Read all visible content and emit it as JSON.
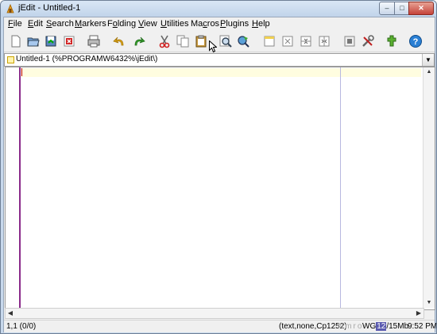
{
  "window": {
    "title": "jEdit - Untitled-1",
    "controls": {
      "minimize": "–",
      "maximize": "□",
      "close": "✕"
    }
  },
  "menu": [
    {
      "label": "File",
      "mnemonic": "F",
      "rest": "ile"
    },
    {
      "label": "Edit",
      "mnemonic": "E",
      "rest": "dit"
    },
    {
      "label": "Search",
      "mnemonic": "S",
      "rest": "earch"
    },
    {
      "label": "Markers",
      "mnemonic": "M",
      "rest": "arkers"
    },
    {
      "label": "Folding",
      "mnemonic": "o",
      "pre": "F",
      "rest": "lding"
    },
    {
      "label": "View",
      "mnemonic": "V",
      "rest": "iew"
    },
    {
      "label": "Utilities",
      "mnemonic": "U",
      "rest": "tilities"
    },
    {
      "label": "Macros",
      "mnemonic": "c",
      "pre": "Ma",
      "rest": "ros"
    },
    {
      "label": "Plugins",
      "mnemonic": "P",
      "rest": "lugins"
    },
    {
      "label": "Help",
      "mnemonic": "H",
      "rest": "elp"
    }
  ],
  "toolbar": {
    "icons": [
      "new-file-icon",
      "open-file-icon",
      "save-file-icon",
      "close-file-icon",
      "print-icon",
      "undo-icon",
      "redo-icon",
      "cut-icon",
      "copy-icon",
      "paste-icon",
      "find-icon",
      "find-next-icon",
      "new-view-icon",
      "unsplit-icon",
      "split-horizontal-icon",
      "split-vertical-icon",
      "buffer-options-icon",
      "global-options-icon",
      "plugin-manager-icon",
      "help-icon"
    ]
  },
  "buffer": {
    "label": "Untitled-1 (%PROGRAMW6432%\\jEdit\\)"
  },
  "status": {
    "position": "1,1 (0/0)",
    "mode": "(text,none,Cp1252)",
    "flags": "Nmro",
    "memory_prefix": "WG",
    "memory_highlight": "12",
    "memory_suffix": "/15Mb",
    "time": "9:52 PM"
  },
  "colors": {
    "gutter_border": "#8a2a8a",
    "caret": "#c00000",
    "current_line": "#fffde0",
    "wrap_guide": "#b8b8e0"
  }
}
